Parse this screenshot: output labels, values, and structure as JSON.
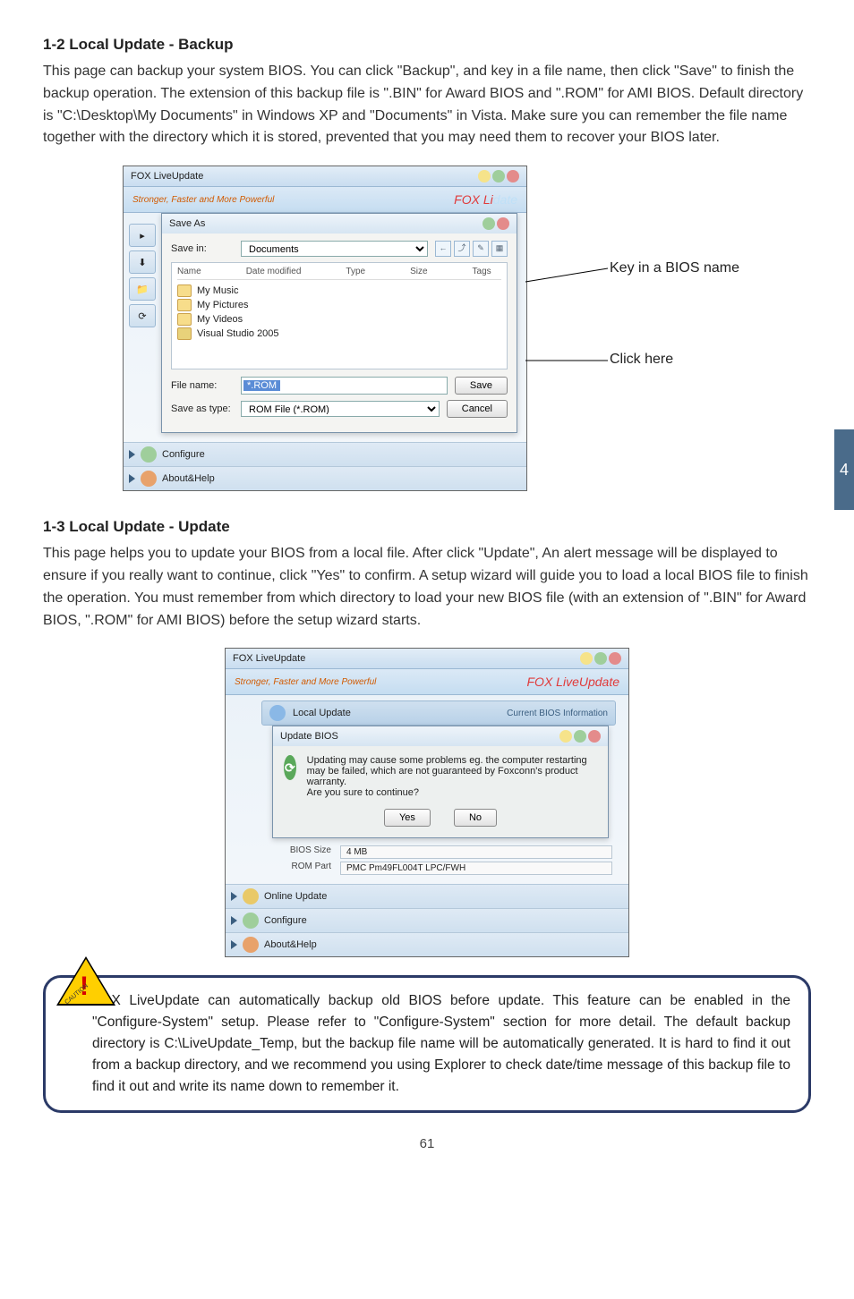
{
  "side_tab": "4",
  "section1": {
    "title": "1-2 Local Update - Backup",
    "text": "This page can backup your system BIOS. You can click \"Backup\", and key in a file name, then click \"Save\" to finish the backup operation. The extension of this backup file is \".BIN\" for Award BIOS and \".ROM\" for AMI BIOS. Default directory is \"C:\\Desktop\\My Documents\" in Windows XP and \"Documents\" in Vista. Make sure you can remember the file name together with the directory which it is stored, prevented that you may need them to recover your BIOS later."
  },
  "shot1": {
    "app_title": "FOX LiveUpdate",
    "tagline": "Stronger, Faster and More Powerful",
    "brand_partial_pre": "FOX Li",
    "brand_partial_post": "date",
    "saveas_title": "Save As",
    "savein_label": "Save in:",
    "savein_value": "Documents",
    "headers": {
      "name": "Name",
      "date": "Date modified",
      "type": "Type",
      "size": "Size",
      "tags": "Tags"
    },
    "folders": [
      "My Music",
      "My Pictures",
      "My Videos",
      "Visual Studio 2005"
    ],
    "filename_label": "File name:",
    "filename_value": "*.ROM",
    "saveastype_label": "Save as type:",
    "saveastype_value": "ROM File (*.ROM)",
    "btn_save": "Save",
    "btn_cancel": "Cancel",
    "nav": {
      "configure": "Configure",
      "about": "About&Help"
    },
    "anno_key": "Key in a BIOS name",
    "anno_click": "Click here"
  },
  "section2": {
    "title": "1-3 Local Update - Update",
    "text": "This page helps you to update your BIOS from a local file. After click \"Update\", An alert message will be displayed to ensure if you really want to continue, click \"Yes\" to confirm. A setup wizard will guide you to load a local BIOS file to finish the operation. You must remember from which directory to load your new BIOS file (with an extension of \".BIN\" for Award BIOS, \".ROM\" for AMI BIOS) before the setup wizard starts."
  },
  "shot2": {
    "app_title": "FOX LiveUpdate",
    "tagline": "Stronger, Faster and More Powerful",
    "brand": "FOX LiveUpdate",
    "local_update": "Local Update",
    "current_bios": "Current BIOS Information",
    "upd_title": "Update BIOS",
    "msg": "Updating may cause some problems eg. the computer restarting may be failed, which are not guaranteed by Foxconn's product warranty.\nAre you sure to continue?",
    "btn_yes": "Yes",
    "btn_no": "No",
    "rows": [
      {
        "label": "BIOS Size",
        "val": "4 MB"
      },
      {
        "label": "ROM Part",
        "val": "PMC Pm49FL004T LPC/FWH"
      }
    ],
    "nav": {
      "online": "Online Update",
      "configure": "Configure",
      "about": "About&Help"
    }
  },
  "caution": {
    "badge_text": "CAUTION",
    "bang": "!",
    "text": "FOX LiveUpdate can automatically backup old BIOS before update. This feature can be enabled in the \"Configure-System\" setup. Please refer to \"Configure-System\" section for more detail. The default backup directory is C:\\LiveUpdate_Temp, but the backup file name will be automatically generated. It is hard to find it out from a backup directory, and we recommend you using Explorer to check date/time message of this backup file to find it out and write its name down to remember it."
  },
  "page_number": "61"
}
